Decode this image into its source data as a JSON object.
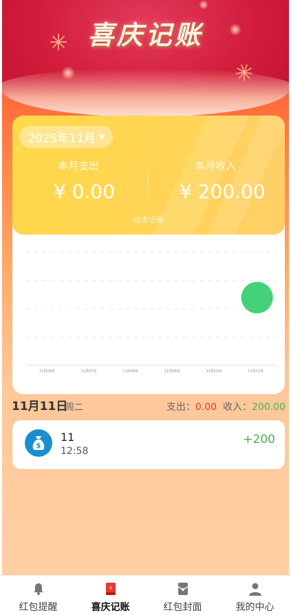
{
  "header": {
    "title": "喜庆记账"
  },
  "summary": {
    "month": "2025年11月",
    "expense_label": "本月支出",
    "income_label": "本月收入",
    "expense_value": "¥ 0.00",
    "income_value": "¥ 200.00",
    "record_link": "-点击记账-"
  },
  "chart_data": {
    "type": "scatter",
    "x": [
      "11月06日",
      "11月07日",
      "11月08日",
      "11月09日",
      "11月10日",
      "11月11日"
    ],
    "values": [
      0,
      0,
      0,
      0,
      0,
      200
    ],
    "xlabel": "",
    "ylabel": "",
    "grid": true,
    "marker_color": "#43d17a"
  },
  "day": {
    "date": "11月11日",
    "weekday": "周二",
    "expense_label": "支出：",
    "expense_value": "0.00",
    "income_label": "收入：",
    "income_value": "200.00"
  },
  "entries": [
    {
      "title": "11",
      "time": "12:58",
      "amount": "+200",
      "icon": "money-bag-icon"
    }
  ],
  "tabs": [
    {
      "label": "红包提醒",
      "icon": "bell-icon"
    },
    {
      "label": "喜庆记账",
      "icon": "ledger-icon"
    },
    {
      "label": "红包封面",
      "icon": "red-envelope-icon"
    },
    {
      "label": "我的中心",
      "icon": "user-icon"
    }
  ],
  "colors": {
    "accent_red": "#e53935",
    "income_green": "#4caf50",
    "card_yellow": "#ffd84a"
  }
}
